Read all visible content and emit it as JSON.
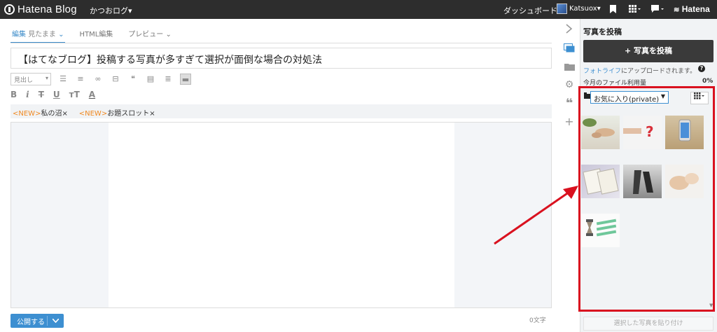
{
  "topbar": {
    "logo_text": "Hatena Blog",
    "blog_name": "かつおログ▾",
    "dashboard": "ダッシュボード",
    "user_name": "Katsuox▾",
    "bookmark_icon": "bookmark-icon",
    "apps_icon": "grid-icon",
    "notify_icon": "chat-icon",
    "brand": "Hatena"
  },
  "editor": {
    "tabs": [
      {
        "label": "編集",
        "sub": "見たまま",
        "chevron": "⌄"
      },
      {
        "label": "HTML編集",
        "sub": "",
        "chevron": ""
      },
      {
        "label": "プレビュー",
        "sub": "",
        "chevron": "⌄"
      }
    ],
    "title": "【はてなブログ】投稿する写真が多すぎて選択が面倒な場合の対処法",
    "format_select": "見出し",
    "tags": [
      {
        "new": "<NEW>",
        "label": "私の沼",
        "close": "×"
      },
      {
        "new": "<NEW>",
        "label": "お題スロット",
        "close": "×"
      }
    ],
    "publish_label": "公開する",
    "char_count": "0文字"
  },
  "panel": {
    "title": "写真を投稿",
    "post_button": "+ 写真を投稿",
    "upload_link": "フォトライフ",
    "upload_note": "にアップロードされます。",
    "help": "?",
    "usage_label": "今月のファイル利用量",
    "usage_value": "0%",
    "album_select": "お気に入り(private)",
    "paste_button": "選択した写真を貼り付け"
  },
  "colors": {
    "accent": "#3d8fd1",
    "highlight": "#d9111f",
    "topbar": "#2d2d2d",
    "new_tag": "#f08a24"
  }
}
